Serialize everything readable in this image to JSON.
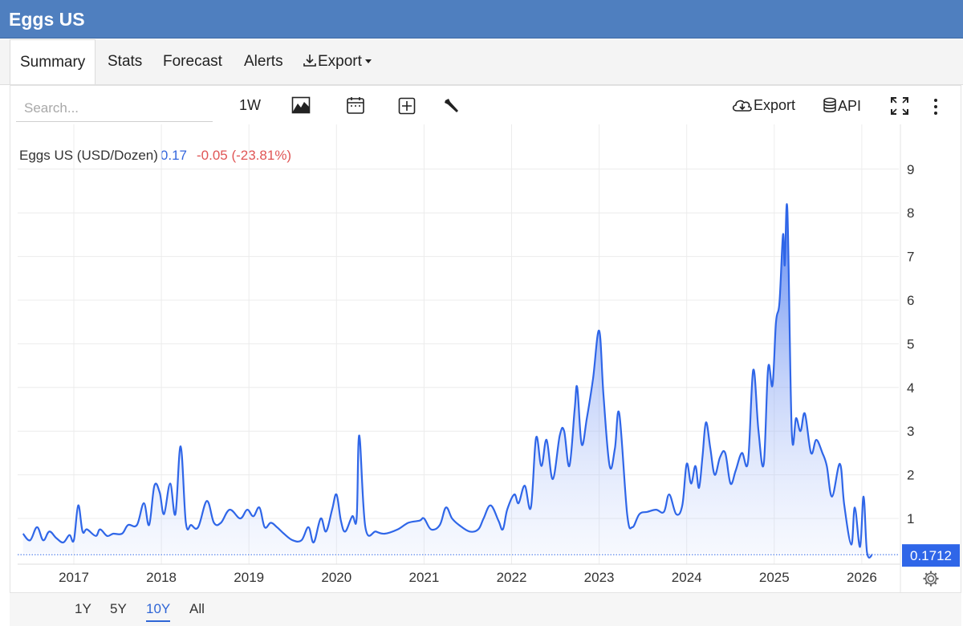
{
  "app": {
    "title": "Eggs US"
  },
  "tabs": [
    {
      "label": "Summary",
      "active": true
    },
    {
      "label": "Stats"
    },
    {
      "label": "Forecast"
    },
    {
      "label": "Alerts"
    },
    {
      "label": "Export"
    }
  ],
  "toolbar": {
    "search_placeholder": "Search...",
    "interval": "1W",
    "export_label": "Export",
    "api_label": "API",
    "icons": [
      "area-chart-icon",
      "calendar-icon",
      "compare-plus-icon",
      "wrench-icon",
      "cloud-download-icon",
      "database-icon",
      "fullscreen-icon",
      "more-vertical-icon"
    ]
  },
  "legend": {
    "name": "Eggs US (USD/Dozen)",
    "last": "0.17",
    "change": "-0.05 (-23.81%)"
  },
  "price_label": "0.1712",
  "ranges": [
    {
      "label": "1Y"
    },
    {
      "label": "5Y"
    },
    {
      "label": "10Y",
      "active": true
    },
    {
      "label": "All"
    }
  ],
  "colors": {
    "header": "#4f7fbf",
    "line": "#2f66e8",
    "fill": "#5b86f0",
    "down": "#e05555",
    "badge": "#2f66e8"
  },
  "chart_data": {
    "type": "area",
    "x_ticks": [
      "2017",
      "2018",
      "2019",
      "2020",
      "2021",
      "2022",
      "2023",
      "2024",
      "2025",
      "2026"
    ],
    "y_ticks": [
      "1",
      "2",
      "3",
      "4",
      "5",
      "6",
      "7",
      "8",
      "9"
    ],
    "ylim": [
      0.1,
      9.3
    ],
    "xlim": [
      2016.4,
      2026.7
    ],
    "grid": true,
    "series": [
      {
        "name": "Eggs US (USD/Dozen)",
        "points": [
          [
            2016.42,
            0.65
          ],
          [
            2016.5,
            0.5
          ],
          [
            2016.58,
            0.8
          ],
          [
            2016.65,
            0.5
          ],
          [
            2016.72,
            0.7
          ],
          [
            2016.8,
            0.55
          ],
          [
            2016.88,
            0.45
          ],
          [
            2016.95,
            0.62
          ],
          [
            2017.0,
            0.5
          ],
          [
            2017.05,
            1.3
          ],
          [
            2017.1,
            0.7
          ],
          [
            2017.15,
            0.75
          ],
          [
            2017.25,
            0.6
          ],
          [
            2017.3,
            0.75
          ],
          [
            2017.38,
            0.6
          ],
          [
            2017.45,
            0.65
          ],
          [
            2017.55,
            0.65
          ],
          [
            2017.62,
            0.85
          ],
          [
            2017.72,
            0.85
          ],
          [
            2017.8,
            1.35
          ],
          [
            2017.86,
            0.85
          ],
          [
            2017.92,
            1.75
          ],
          [
            2017.98,
            1.6
          ],
          [
            2018.03,
            1.1
          ],
          [
            2018.1,
            1.8
          ],
          [
            2018.16,
            1.1
          ],
          [
            2018.22,
            2.65
          ],
          [
            2018.28,
            0.9
          ],
          [
            2018.34,
            0.85
          ],
          [
            2018.42,
            0.8
          ],
          [
            2018.52,
            1.4
          ],
          [
            2018.6,
            0.9
          ],
          [
            2018.68,
            0.9
          ],
          [
            2018.78,
            1.2
          ],
          [
            2018.9,
            1.0
          ],
          [
            2018.98,
            1.2
          ],
          [
            2019.05,
            1.05
          ],
          [
            2019.12,
            1.25
          ],
          [
            2019.18,
            0.8
          ],
          [
            2019.25,
            0.9
          ],
          [
            2019.32,
            0.8
          ],
          [
            2019.4,
            0.65
          ],
          [
            2019.5,
            0.5
          ],
          [
            2019.6,
            0.5
          ],
          [
            2019.68,
            0.8
          ],
          [
            2019.74,
            0.45
          ],
          [
            2019.82,
            1.0
          ],
          [
            2019.88,
            0.7
          ],
          [
            2019.95,
            1.2
          ],
          [
            2020.0,
            1.55
          ],
          [
            2020.05,
            0.95
          ],
          [
            2020.1,
            0.7
          ],
          [
            2020.18,
            1.05
          ],
          [
            2020.23,
            1.0
          ],
          [
            2020.26,
            2.9
          ],
          [
            2020.33,
            0.8
          ],
          [
            2020.45,
            0.7
          ],
          [
            2020.55,
            0.65
          ],
          [
            2020.7,
            0.75
          ],
          [
            2020.82,
            0.9
          ],
          [
            2020.95,
            0.95
          ],
          [
            2021.0,
            1.0
          ],
          [
            2021.08,
            0.75
          ],
          [
            2021.18,
            0.85
          ],
          [
            2021.25,
            1.25
          ],
          [
            2021.32,
            1.0
          ],
          [
            2021.4,
            0.85
          ],
          [
            2021.52,
            0.7
          ],
          [
            2021.62,
            0.75
          ],
          [
            2021.68,
            1.0
          ],
          [
            2021.76,
            1.3
          ],
          [
            2021.85,
            0.95
          ],
          [
            2021.9,
            0.75
          ],
          [
            2021.95,
            1.2
          ],
          [
            2022.03,
            1.55
          ],
          [
            2022.08,
            1.35
          ],
          [
            2022.15,
            1.75
          ],
          [
            2022.22,
            1.25
          ],
          [
            2022.28,
            2.85
          ],
          [
            2022.34,
            2.2
          ],
          [
            2022.4,
            2.8
          ],
          [
            2022.47,
            1.9
          ],
          [
            2022.55,
            2.9
          ],
          [
            2022.6,
            3.0
          ],
          [
            2022.66,
            2.2
          ],
          [
            2022.72,
            3.5
          ],
          [
            2022.75,
            4.0
          ],
          [
            2022.8,
            2.7
          ],
          [
            2022.86,
            3.3
          ],
          [
            2022.93,
            4.2
          ],
          [
            2023.0,
            5.3
          ],
          [
            2023.05,
            3.8
          ],
          [
            2023.12,
            2.2
          ],
          [
            2023.18,
            2.6
          ],
          [
            2023.23,
            3.4
          ],
          [
            2023.32,
            1.1
          ],
          [
            2023.38,
            0.8
          ],
          [
            2023.46,
            1.1
          ],
          [
            2023.55,
            1.15
          ],
          [
            2023.65,
            1.2
          ],
          [
            2023.74,
            1.15
          ],
          [
            2023.8,
            1.55
          ],
          [
            2023.88,
            1.1
          ],
          [
            2023.95,
            1.3
          ],
          [
            2024.0,
            2.25
          ],
          [
            2024.05,
            1.8
          ],
          [
            2024.1,
            2.2
          ],
          [
            2024.14,
            1.7
          ],
          [
            2024.18,
            2.4
          ],
          [
            2024.22,
            3.2
          ],
          [
            2024.27,
            2.6
          ],
          [
            2024.32,
            2.0
          ],
          [
            2024.38,
            2.4
          ],
          [
            2024.44,
            2.5
          ],
          [
            2024.5,
            1.8
          ],
          [
            2024.56,
            2.1
          ],
          [
            2024.63,
            2.5
          ],
          [
            2024.7,
            2.3
          ],
          [
            2024.76,
            4.4
          ],
          [
            2024.82,
            3.0
          ],
          [
            2024.88,
            2.25
          ],
          [
            2024.93,
            4.45
          ],
          [
            2024.98,
            4.05
          ],
          [
            2025.02,
            5.5
          ],
          [
            2025.06,
            5.95
          ],
          [
            2025.1,
            7.5
          ],
          [
            2025.12,
            6.8
          ],
          [
            2025.15,
            8.05
          ],
          [
            2025.2,
            3.0
          ],
          [
            2025.25,
            3.3
          ],
          [
            2025.3,
            3.0
          ],
          [
            2025.35,
            3.4
          ],
          [
            2025.42,
            2.5
          ],
          [
            2025.48,
            2.8
          ],
          [
            2025.55,
            2.5
          ],
          [
            2025.6,
            2.2
          ],
          [
            2025.66,
            1.5
          ],
          [
            2025.75,
            2.25
          ],
          [
            2025.8,
            1.3
          ],
          [
            2025.88,
            0.4
          ],
          [
            2025.92,
            1.25
          ],
          [
            2025.98,
            0.35
          ],
          [
            2026.02,
            1.5
          ],
          [
            2026.06,
            0.22
          ],
          [
            2026.12,
            0.17
          ]
        ]
      }
    ]
  }
}
